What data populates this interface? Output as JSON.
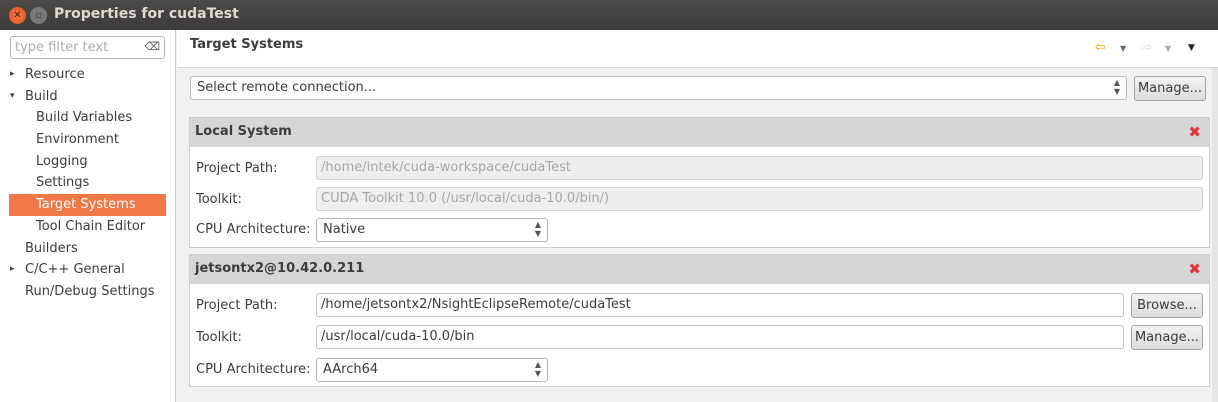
{
  "window": {
    "title": "Properties for cudaTest"
  },
  "sidebar": {
    "filter_placeholder": "type filter text",
    "items": [
      {
        "label": "Resource",
        "level": 0,
        "twisty": "▸"
      },
      {
        "label": "Build",
        "level": 0,
        "twisty": "▾"
      },
      {
        "label": "Build Variables",
        "level": 1
      },
      {
        "label": "Environment",
        "level": 1
      },
      {
        "label": "Logging",
        "level": 1
      },
      {
        "label": "Settings",
        "level": 1
      },
      {
        "label": "Target Systems",
        "level": 1,
        "selected": true
      },
      {
        "label": "Tool Chain Editor",
        "level": 1
      },
      {
        "label": "Builders",
        "level": 0
      },
      {
        "label": "C/C++ General",
        "level": 0,
        "twisty": "▸"
      },
      {
        "label": "Run/Debug Settings",
        "level": 0
      }
    ]
  },
  "page": {
    "title": "Target Systems",
    "remote_connection": "Select remote connection...",
    "manage_label": "Manage...",
    "local": {
      "title": "Local System",
      "project_path_label": "Project Path:",
      "project_path": "/home/intek/cuda-workspace/cudaTest",
      "toolkit_label": "Toolkit:",
      "toolkit": "CUDA Toolkit 10.0 (/usr/local/cuda-10.0/bin/)",
      "cpu_label": "CPU Architecture:",
      "cpu": "Native"
    },
    "remote": {
      "title": "jetsontx2@10.42.0.211",
      "project_path_label": "Project Path:",
      "project_path": "/home/jetsontx2/NsightEclipseRemote/cudaTest",
      "browse_label": "Browse...",
      "toolkit_label": "Toolkit:",
      "toolkit": "/usr/local/cuda-10.0/bin",
      "manage_label": "Manage...",
      "cpu_label": "CPU Architecture:",
      "cpu": "AArch64"
    }
  }
}
